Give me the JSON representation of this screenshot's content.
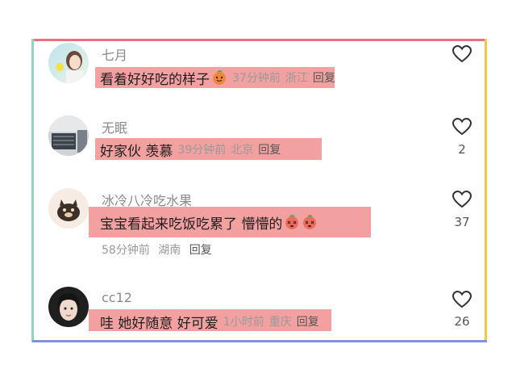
{
  "colors": {
    "frame_top": "#f0707a",
    "frame_left": "#8fd4c4",
    "frame_right": "#f3c54a",
    "frame_bottom": "#7f92e0",
    "highlight": "#f3a0a0"
  },
  "comments": [
    {
      "username": "七月",
      "text": "看着好好吃的样子",
      "emoji": "peach-smile-icon",
      "time": "37分钟前",
      "location": "浙江",
      "reply": "回复",
      "likes": ""
    },
    {
      "username": "无眠",
      "text": "好家伙 羡慕",
      "time": "39分钟前",
      "location": "北京",
      "reply": "回复",
      "likes": "2"
    },
    {
      "username": "冰冷八冷吃水果",
      "text": "宝宝看起来吃饭吃累了 懵懵的",
      "emoji": "peach-dizzy-icon",
      "time": "58分钟前",
      "location": "湖南",
      "reply": "回复",
      "likes": "37"
    },
    {
      "username": "cc12",
      "text": "哇 她好随意 好可爱",
      "time": "1小时前",
      "location": "重庆",
      "reply": "回复",
      "likes": "26"
    }
  ]
}
